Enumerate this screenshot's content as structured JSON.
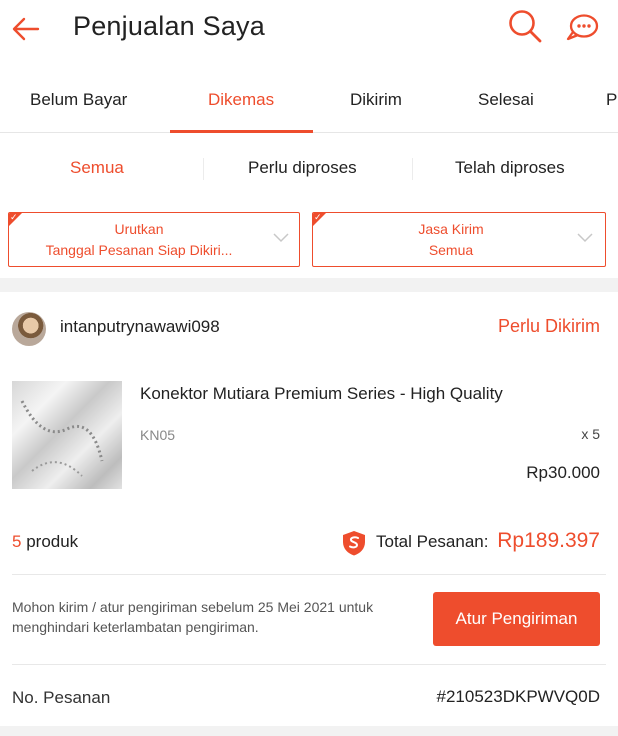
{
  "header": {
    "title": "Penjualan Saya",
    "back_icon": "arrow-left-icon",
    "search_icon": "search-icon",
    "chat_icon": "chat-bubble-icon"
  },
  "tabs": [
    {
      "label": "Belum Bayar",
      "active": false
    },
    {
      "label": "Dikemas",
      "active": true
    },
    {
      "label": "Dikirim",
      "active": false
    },
    {
      "label": "Selesai",
      "active": false
    },
    {
      "label": "P",
      "active": false
    }
  ],
  "subtabs": [
    {
      "label": "Semua",
      "active": true
    },
    {
      "label": "Perlu diproses",
      "active": false
    },
    {
      "label": "Telah diproses",
      "active": false
    }
  ],
  "filters": {
    "sort": {
      "label": "Urutkan",
      "value": "Tanggal Pesanan Siap Dikiri..."
    },
    "courier": {
      "label": "Jasa Kirim",
      "value": "Semua"
    }
  },
  "order": {
    "shop_name": "intanputrynawawi098",
    "status": "Perlu Dikirim",
    "product": {
      "name": "Konektor Mutiara Premium Series - High Quality",
      "variant": "KN05",
      "quantity": "x 5",
      "price": "Rp30.000"
    },
    "product_count_num": "5",
    "product_count_label": "produk",
    "total_label": "Total Pesanan:",
    "total_value": "Rp189.397",
    "notice": "Mohon kirim / atur pengiriman sebelum 25 Mei 2021 untuk menghindari keterlambatan pengiriman.",
    "ship_button": "Atur Pengiriman",
    "order_no_label": "No. Pesanan",
    "order_no_value": "#210523DKPWVQ0D"
  },
  "colors": {
    "accent": "#ee4d2d",
    "divider": "#e8e8e8",
    "section_gap": "#f2f2f2"
  }
}
